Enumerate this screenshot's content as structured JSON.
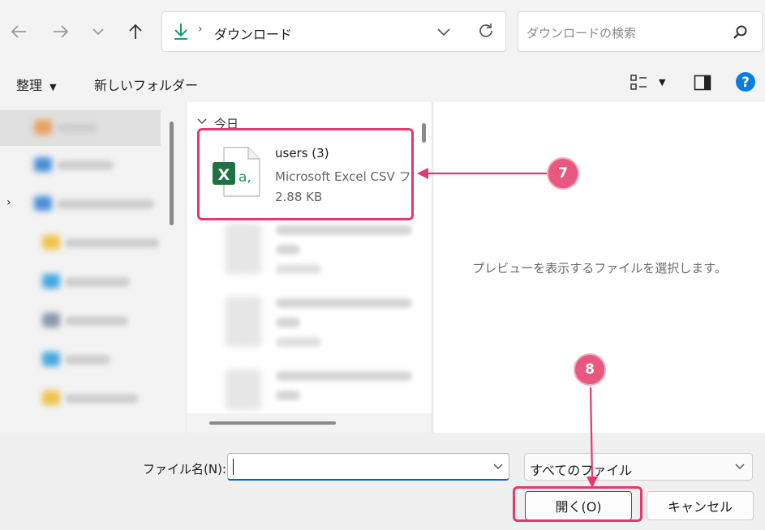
{
  "address": {
    "path": "ダウンロード"
  },
  "search": {
    "placeholder": "ダウンロードの検索"
  },
  "toolbar": {
    "organize": "整理",
    "new_folder": "新しいフォルダー"
  },
  "filelist": {
    "group": "今日",
    "selected_file": {
      "name": "users (3)",
      "type": "Microsoft Excel CSV フ",
      "size": "2.88 KB",
      "icon_text": "a,"
    }
  },
  "preview": {
    "message": "プレビューを表示するファイルを選択します。"
  },
  "bottom": {
    "filename_label": "ファイル名(N):",
    "filename_value": "",
    "filetype": "すべてのファイル",
    "open_button": "開く(O)",
    "cancel_button": "キャンセル"
  },
  "annotations": {
    "step7": "7",
    "step8": "8"
  },
  "colors": {
    "accent": "#0067c0",
    "callout": "#e5386d",
    "badge": "#e8577f",
    "excel": "#1f7244"
  }
}
